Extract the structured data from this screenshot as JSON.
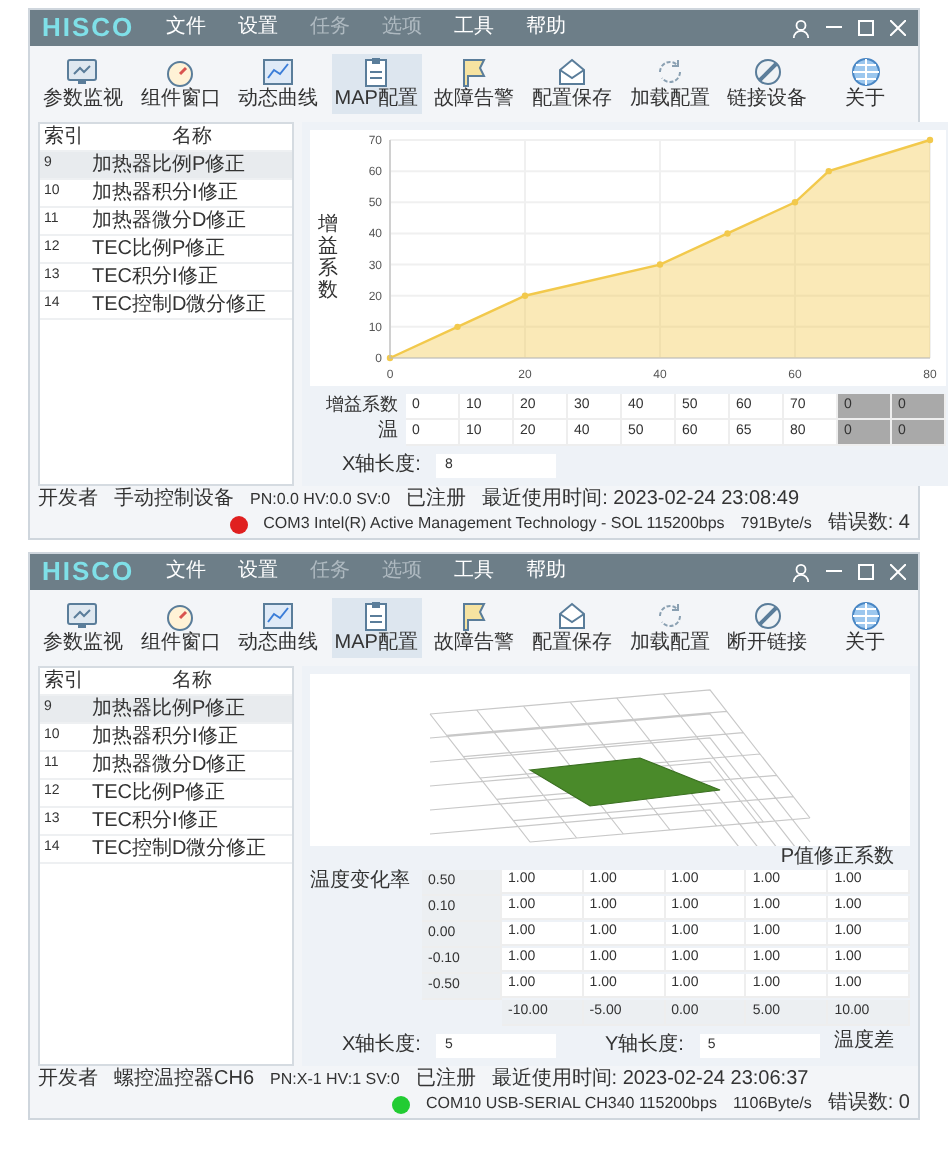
{
  "windows": [
    {
      "title_bar": {
        "logo": "HISCO",
        "menu": [
          {
            "label": "文件",
            "disabled": false
          },
          {
            "label": "设置",
            "disabled": false
          },
          {
            "label": "任务",
            "disabled": true
          },
          {
            "label": "选项",
            "disabled": true
          },
          {
            "label": "工具",
            "disabled": false
          },
          {
            "label": "帮助",
            "disabled": false
          }
        ]
      },
      "toolbar": [
        {
          "label": "参数监视",
          "kind": "monitor",
          "selected": false
        },
        {
          "label": "组件窗口",
          "kind": "gauge",
          "selected": false
        },
        {
          "label": "动态曲线",
          "kind": "chart",
          "selected": false
        },
        {
          "label": "MAP配置",
          "kind": "clipboard",
          "selected": true
        },
        {
          "label": "故障告警",
          "kind": "flag",
          "selected": false
        },
        {
          "label": "配置保存",
          "kind": "envelope",
          "selected": false
        },
        {
          "label": "加载配置",
          "kind": "refresh",
          "selected": false
        },
        {
          "label": "链接设备",
          "kind": "link",
          "selected": false
        },
        {
          "label": "关于",
          "kind": "globe",
          "selected": false
        }
      ],
      "sidebar": {
        "columns": [
          "索引",
          "名称"
        ],
        "rows": [
          {
            "index": "9",
            "name": "加热器比例P修正",
            "selected": true
          },
          {
            "index": "10",
            "name": "加热器积分I修正",
            "selected": false
          },
          {
            "index": "11",
            "name": "加热器微分D修正",
            "selected": false
          },
          {
            "index": "12",
            "name": "TEC比例P修正",
            "selected": false
          },
          {
            "index": "13",
            "name": "TEC积分I修正",
            "selected": false
          },
          {
            "index": "14",
            "name": "TEC控制D微分修正",
            "selected": false
          }
        ]
      },
      "content": {
        "kind": "curve",
        "chart_data": {
          "type": "area",
          "ylabel": "增益系数",
          "x": [
            0,
            10,
            20,
            40,
            50,
            60,
            65,
            80
          ],
          "grid": true,
          "series": [
            {
              "color": "#f2c94c",
              "values": [
                0,
                10,
                20,
                30,
                40,
                50,
                60,
                70
              ]
            }
          ],
          "xlim": [
            0,
            80
          ],
          "ylim": [
            0,
            70
          ],
          "xticks": [
            0,
            20,
            40,
            60,
            80
          ],
          "yticks": [
            0,
            10,
            20,
            30,
            40,
            50,
            60,
            70
          ]
        },
        "table": {
          "rows": [
            {
              "label": "增益系数",
              "cells": [
                {
                  "text": "0",
                  "disabled": false
                },
                {
                  "text": "10",
                  "disabled": false
                },
                {
                  "text": "20",
                  "disabled": false
                },
                {
                  "text": "30",
                  "disabled": false
                },
                {
                  "text": "40",
                  "disabled": false
                },
                {
                  "text": "50",
                  "disabled": false
                },
                {
                  "text": "60",
                  "disabled": false
                },
                {
                  "text": "70",
                  "disabled": false
                },
                {
                  "text": "0",
                  "disabled": true
                },
                {
                  "text": "0",
                  "disabled": true
                }
              ]
            },
            {
              "label": "温",
              "cells": [
                {
                  "text": "0",
                  "disabled": false
                },
                {
                  "text": "10",
                  "disabled": false
                },
                {
                  "text": "20",
                  "disabled": false
                },
                {
                  "text": "40",
                  "disabled": false
                },
                {
                  "text": "50",
                  "disabled": false
                },
                {
                  "text": "60",
                  "disabled": false
                },
                {
                  "text": "65",
                  "disabled": false
                },
                {
                  "text": "80",
                  "disabled": false
                },
                {
                  "text": "0",
                  "disabled": true
                },
                {
                  "text": "0",
                  "disabled": true
                }
              ]
            }
          ]
        },
        "axis_fields": [
          {
            "label": "X轴长度:",
            "value": "8"
          }
        ]
      },
      "status_bar": {
        "fields": [
          "开发者",
          "手动控制设备",
          "PN:0.0 HV:0.0 SV:0",
          "已注册",
          "最近使用时间: 2023-02-24 23:08:49"
        ],
        "port": {
          "text": "COM3 Intel(R) Active Management Technology - SOL 115200bps",
          "color": "#e02020"
        },
        "rate": "791Byte/s",
        "errors": "错误数: 4"
      }
    },
    {
      "title_bar": {
        "logo": "HISCO",
        "menu": [
          {
            "label": "文件",
            "disabled": false
          },
          {
            "label": "设置",
            "disabled": false
          },
          {
            "label": "任务",
            "disabled": true
          },
          {
            "label": "选项",
            "disabled": true
          },
          {
            "label": "工具",
            "disabled": false
          },
          {
            "label": "帮助",
            "disabled": false
          }
        ]
      },
      "toolbar": [
        {
          "label": "参数监视",
          "kind": "monitor",
          "selected": false
        },
        {
          "label": "组件窗口",
          "kind": "gauge",
          "selected": false
        },
        {
          "label": "动态曲线",
          "kind": "chart",
          "selected": false
        },
        {
          "label": "MAP配置",
          "kind": "clipboard",
          "selected": true
        },
        {
          "label": "故障告警",
          "kind": "flag",
          "selected": false
        },
        {
          "label": "配置保存",
          "kind": "envelope",
          "selected": false
        },
        {
          "label": "加载配置",
          "kind": "refresh",
          "selected": false
        },
        {
          "label": "断开链接",
          "kind": "link",
          "selected": false
        },
        {
          "label": "关于",
          "kind": "globe",
          "selected": false
        }
      ],
      "sidebar": {
        "columns": [
          "索引",
          "名称"
        ],
        "rows": [
          {
            "index": "9",
            "name": "加热器比例P修正",
            "selected": true
          },
          {
            "index": "10",
            "name": "加热器积分I修正",
            "selected": false
          },
          {
            "index": "11",
            "name": "加热器微分D修正",
            "selected": false
          },
          {
            "index": "12",
            "name": "TEC比例P修正",
            "selected": false
          },
          {
            "index": "13",
            "name": "TEC积分I修正",
            "selected": false
          },
          {
            "index": "14",
            "name": "TEC控制D微分修正",
            "selected": false
          }
        ]
      },
      "content": {
        "kind": "map",
        "table_title": "P值修正系数",
        "row_axis_label": "温度变化率",
        "col_axis_label": "温度差",
        "table": {
          "rows": [
            {
              "label": "0.50",
              "cells": [
                "1.00",
                "1.00",
                "1.00",
                "1.00",
                "1.00"
              ]
            },
            {
              "label": "0.10",
              "cells": [
                "1.00",
                "1.00",
                "1.00",
                "1.00",
                "1.00"
              ]
            },
            {
              "label": "0.00",
              "cells": [
                "1.00",
                "1.00",
                "1.00",
                "1.00",
                "1.00"
              ]
            },
            {
              "label": "-0.10",
              "cells": [
                "1.00",
                "1.00",
                "1.00",
                "1.00",
                "1.00"
              ]
            },
            {
              "label": "-0.50",
              "cells": [
                "1.00",
                "1.00",
                "1.00",
                "1.00",
                "1.00"
              ]
            }
          ],
          "footer": [
            "-10.00",
            "-5.00",
            "0.00",
            "5.00",
            "10.00"
          ]
        },
        "axis_fields": [
          {
            "label": "X轴长度:",
            "value": "5"
          },
          {
            "label": "Y轴长度:",
            "value": "5"
          }
        ]
      },
      "status_bar": {
        "fields": [
          "开发者",
          "螺控温控器CH6",
          "PN:X-1 HV:1 SV:0",
          "已注册",
          "最近使用时间: 2023-02-24 23:06:37"
        ],
        "port": {
          "text": "COM10 USB-SERIAL CH340 115200bps",
          "color": "#22cc33"
        },
        "rate": "1106Byte/s",
        "errors": "错误数: 0"
      }
    }
  ]
}
